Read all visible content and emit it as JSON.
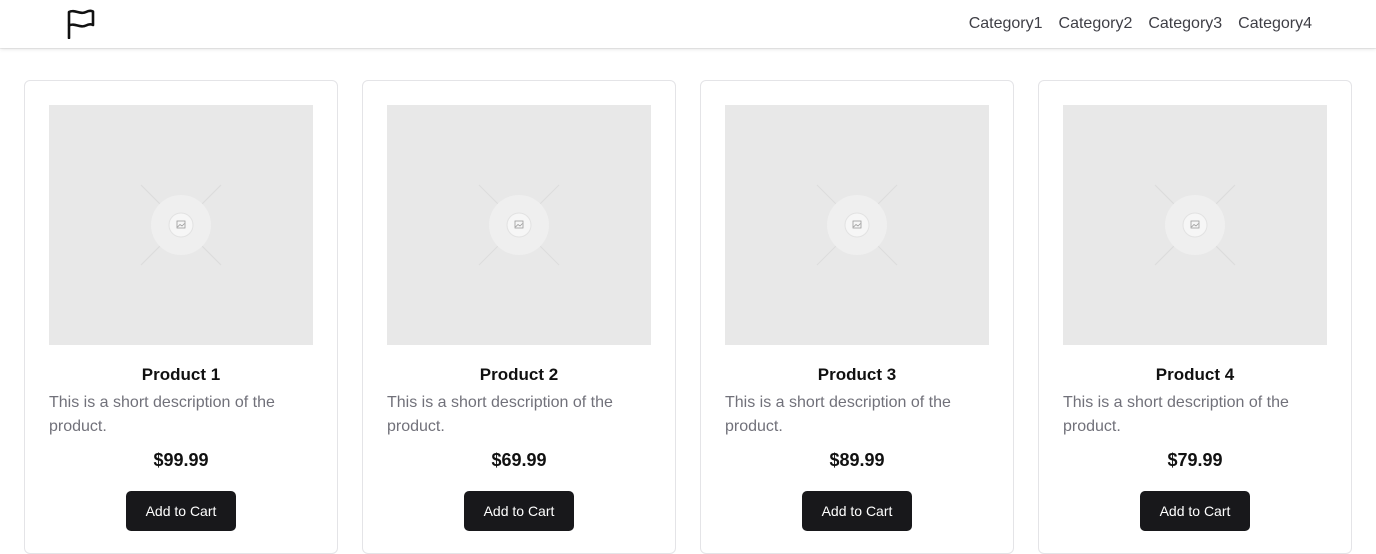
{
  "header": {
    "logo_icon": "flag-icon",
    "nav": [
      "Category1",
      "Category2",
      "Category3",
      "Category4"
    ]
  },
  "products": [
    {
      "title": "Product 1",
      "description": "This is a short description of the product.",
      "price": "$99.99",
      "button": "Add to Cart",
      "image_icon": "image-placeholder-icon"
    },
    {
      "title": "Product 2",
      "description": "This is a short description of the product.",
      "price": "$69.99",
      "button": "Add to Cart",
      "image_icon": "image-placeholder-icon"
    },
    {
      "title": "Product 3",
      "description": "This is a short description of the product.",
      "price": "$89.99",
      "button": "Add to Cart",
      "image_icon": "image-placeholder-icon"
    },
    {
      "title": "Product 4",
      "description": "This is a short description of the product.",
      "price": "$79.99",
      "button": "Add to Cart",
      "image_icon": "image-placeholder-icon"
    }
  ],
  "colors": {
    "button_bg": "#18181b",
    "button_text": "#ffffff",
    "placeholder_bg": "#e8e8e8",
    "description_text": "#71717a",
    "nav_text": "#3f3f46"
  }
}
